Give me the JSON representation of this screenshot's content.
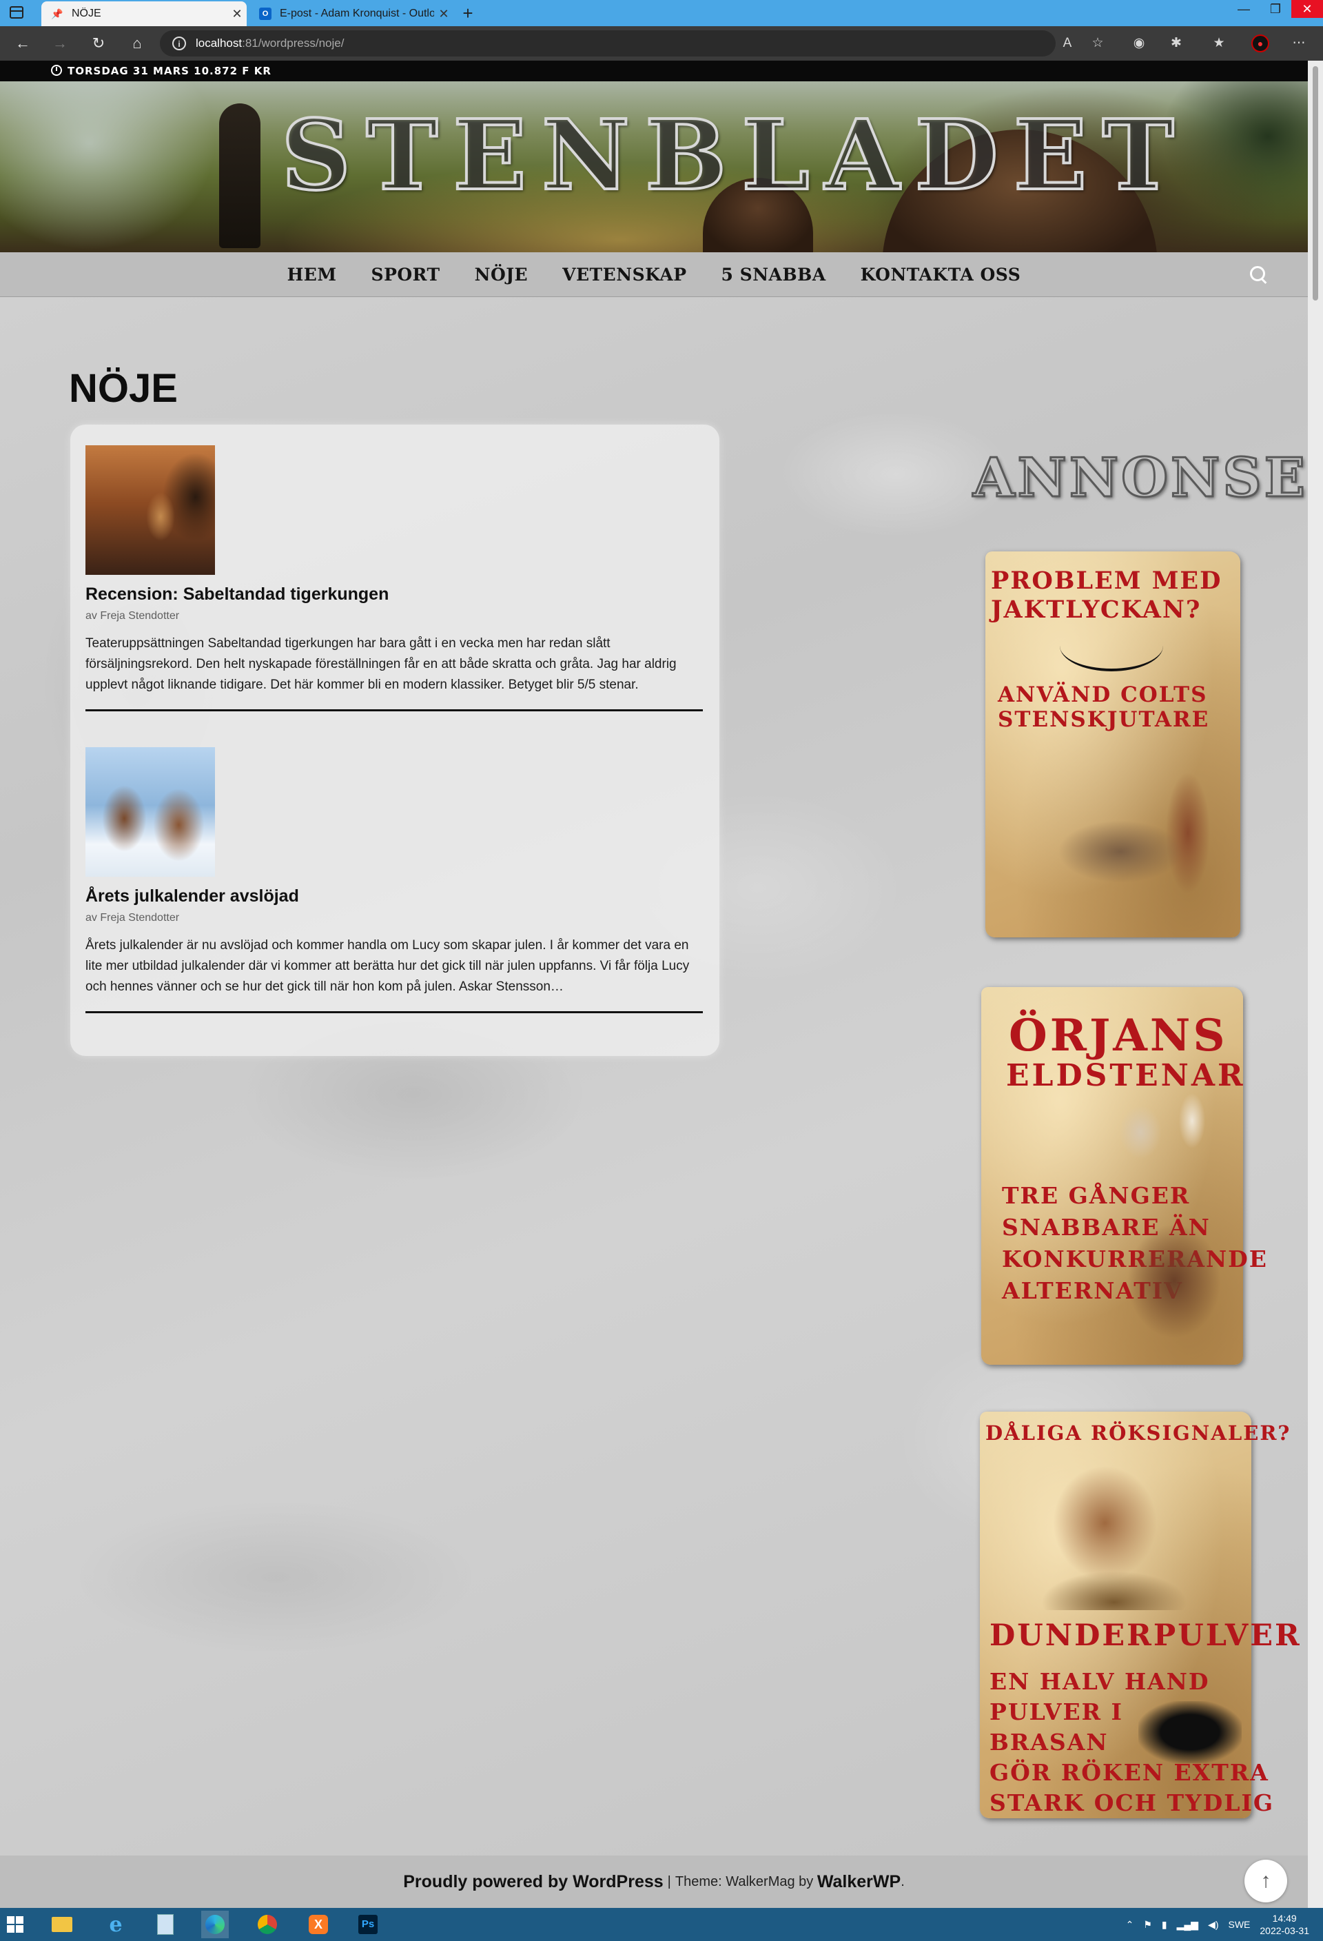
{
  "browser": {
    "tabs": [
      {
        "title": "NÖJE",
        "active": true,
        "favicon": "wordpress-pin-icon"
      },
      {
        "title": "E-post - Adam Kronquist - Outlo",
        "active": false,
        "favicon": "outlook-icon"
      }
    ],
    "url": {
      "host": "localhost",
      "path": ":81/wordpress/noje/"
    }
  },
  "site": {
    "date_bar": "TORSDAG 31 MARS 10.872 F KR",
    "logo": "STENBLADET",
    "menu": [
      "HEM",
      "SPORT",
      "NÖJE",
      "VETENSKAP",
      "5 SNABBA",
      "KONTAKTA OSS"
    ]
  },
  "page": {
    "title": "NÖJE"
  },
  "posts": [
    {
      "title": "Recension: Sabeltandad tigerkungen",
      "author": "av Freja Stendotter",
      "excerpt": "Teateruppsättningen Sabeltandad tigerkungen har bara gått i en vecka men har redan slått försäljningsrekord. Den helt nyskapade föreställningen får en att både skratta och gråta. Jag har aldrig upplevt något liknande tidigare. Det här kommer bli en modern klassiker. Betyget blir 5/5 stenar."
    },
    {
      "title": "Årets julkalender avslöjad",
      "author": "av Freja Stendotter",
      "excerpt": "Årets julkalender är nu avslöjad och kommer handla om Lucy som skapar julen. I år kommer det vara en lite mer utbildad julkalender där vi kommer att berätta hur det gick till när julen uppfanns. Vi får följa Lucy och hennes vänner och se hur det gick till när hon kom på julen. Askar Stensson…"
    }
  ],
  "sidebar": {
    "title": "ANNONSER",
    "ads": [
      {
        "line1": "PROBLEM MED",
        "line2": "JAKTLYCKAN?",
        "line3": "ANVÄND COLTS",
        "line4": "STENSKJUTARE"
      },
      {
        "line1": "ÖRJANS",
        "line2": "ELDSTENAR",
        "line3": "TRE GÅNGER",
        "line4": "SNABBARE ÄN",
        "line5": "KONKURRERANDE",
        "line6": "ALTERNATIV"
      },
      {
        "line1": "DÅLIGA RÖKSIGNALER?",
        "line2": "DUNDERPULVER",
        "line3": "EN HALV HAND",
        "line4": "PULVER I",
        "line5": "BRASAN",
        "line6": "GÖR RÖKEN EXTRA",
        "line7": "STARK OCH TYDLIG"
      }
    ]
  },
  "footer": {
    "powered": "Proudly powered by WordPress",
    "sep": "|",
    "theme_text": "Theme: WalkerMag by",
    "theme_link": "WalkerWP",
    "dot": "."
  },
  "taskbar": {
    "lang": "SWE",
    "time": "14:49",
    "date": "2022-03-31"
  },
  "colors": {
    "accent_tab": "#4aa7e6",
    "ad_text": "#b3161b",
    "taskbar": "#1d5a83"
  }
}
